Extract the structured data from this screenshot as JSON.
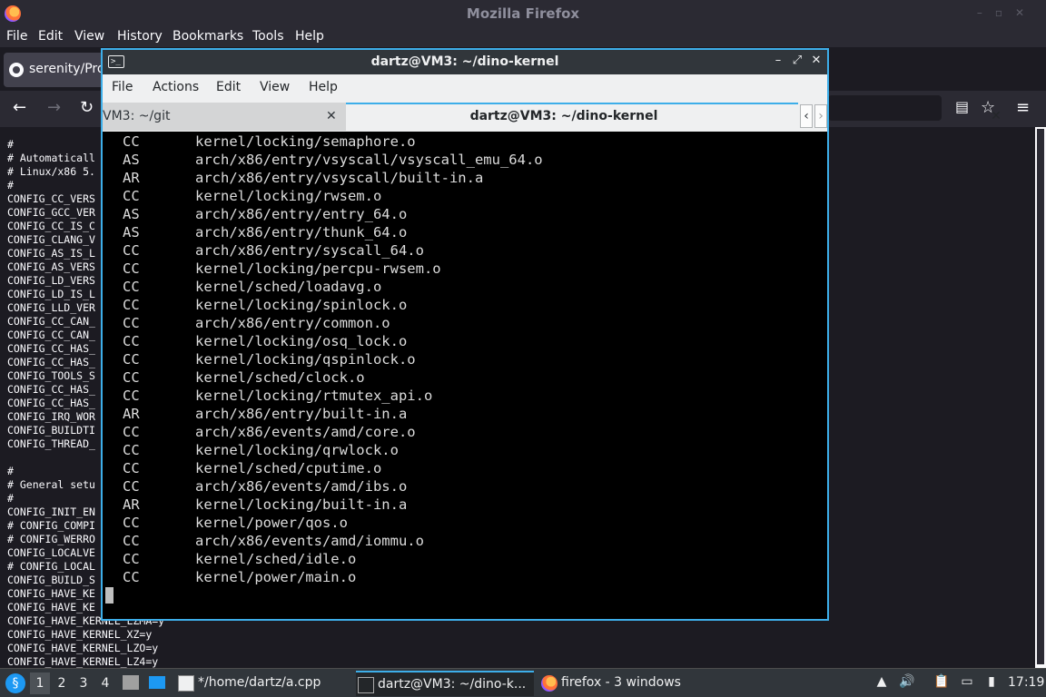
{
  "firefox": {
    "title": "Mozilla Firefox",
    "menu": [
      "File",
      "Edit",
      "View",
      "History",
      "Bookmarks",
      "Tools",
      "Help"
    ],
    "tab_title": "serenity/Pro",
    "content_lines": "#\n# Automaticall\n# Linux/x86 5.\n#\nCONFIG_CC_VERS\nCONFIG_GCC_VER\nCONFIG_CC_IS_C\nCONFIG_CLANG_V\nCONFIG_AS_IS_L\nCONFIG_AS_VERS\nCONFIG_LD_VERS\nCONFIG_LD_IS_L\nCONFIG_LLD_VER\nCONFIG_CC_CAN_\nCONFIG_CC_CAN_\nCONFIG_CC_HAS_\nCONFIG_CC_HAS_\nCONFIG_TOOLS_S\nCONFIG_CC_HAS_\nCONFIG_CC_HAS_\nCONFIG_IRQ_WOR\nCONFIG_BUILDTI\nCONFIG_THREAD_\n\n#\n# General setu\n#\nCONFIG_INIT_EN\n# CONFIG_COMPI\n# CONFIG_WERRO\nCONFIG_LOCALVE\n# CONFIG_LOCAL\nCONFIG_BUILD_S\nCONFIG_HAVE_KE\nCONFIG_HAVE_KE\nCONFIG_HAVE_KERNEL_LZMA=y\nCONFIG_HAVE_KERNEL_XZ=y\nCONFIG_HAVE_KERNEL_LZO=y\nCONFIG_HAVE_KERNEL_LZ4=y"
  },
  "terminal": {
    "title": "dartz@VM3: ~/dino-kernel",
    "menu": [
      "File",
      "Actions",
      "Edit",
      "View",
      "Help"
    ],
    "tabs": [
      "VM3: ~/git",
      "dartz@VM3: ~/dino-kernel"
    ],
    "output": [
      {
        "cmd": "CC",
        "path": "kernel/locking/semaphore.o"
      },
      {
        "cmd": "AS",
        "path": "arch/x86/entry/vsyscall/vsyscall_emu_64.o"
      },
      {
        "cmd": "AR",
        "path": "arch/x86/entry/vsyscall/built-in.a"
      },
      {
        "cmd": "CC",
        "path": "kernel/locking/rwsem.o"
      },
      {
        "cmd": "AS",
        "path": "arch/x86/entry/entry_64.o"
      },
      {
        "cmd": "AS",
        "path": "arch/x86/entry/thunk_64.o"
      },
      {
        "cmd": "CC",
        "path": "arch/x86/entry/syscall_64.o"
      },
      {
        "cmd": "CC",
        "path": "kernel/locking/percpu-rwsem.o"
      },
      {
        "cmd": "CC",
        "path": "kernel/sched/loadavg.o"
      },
      {
        "cmd": "CC",
        "path": "kernel/locking/spinlock.o"
      },
      {
        "cmd": "CC",
        "path": "arch/x86/entry/common.o"
      },
      {
        "cmd": "CC",
        "path": "kernel/locking/osq_lock.o"
      },
      {
        "cmd": "CC",
        "path": "kernel/locking/qspinlock.o"
      },
      {
        "cmd": "CC",
        "path": "kernel/sched/clock.o"
      },
      {
        "cmd": "CC",
        "path": "kernel/locking/rtmutex_api.o"
      },
      {
        "cmd": "AR",
        "path": "arch/x86/entry/built-in.a"
      },
      {
        "cmd": "CC",
        "path": "arch/x86/events/amd/core.o"
      },
      {
        "cmd": "CC",
        "path": "kernel/locking/qrwlock.o"
      },
      {
        "cmd": "CC",
        "path": "kernel/sched/cputime.o"
      },
      {
        "cmd": "CC",
        "path": "arch/x86/events/amd/ibs.o"
      },
      {
        "cmd": "AR",
        "path": "kernel/locking/built-in.a"
      },
      {
        "cmd": "CC",
        "path": "kernel/power/qos.o"
      },
      {
        "cmd": "CC",
        "path": "arch/x86/events/amd/iommu.o"
      },
      {
        "cmd": "CC",
        "path": "kernel/sched/idle.o"
      },
      {
        "cmd": "CC",
        "path": "kernel/power/main.o"
      }
    ]
  },
  "taskbar": {
    "workspaces": [
      "1",
      "2",
      "3",
      "4"
    ],
    "tasks": [
      "*/home/dartz/a.cpp",
      "dartz@VM3: ~/dino-k...",
      "firefox - 3 windows"
    ],
    "clock": "17:19"
  },
  "colors": {
    "accent": "#3daee9",
    "terminal_bg": "#000000",
    "panel_bg": "#31363b"
  }
}
